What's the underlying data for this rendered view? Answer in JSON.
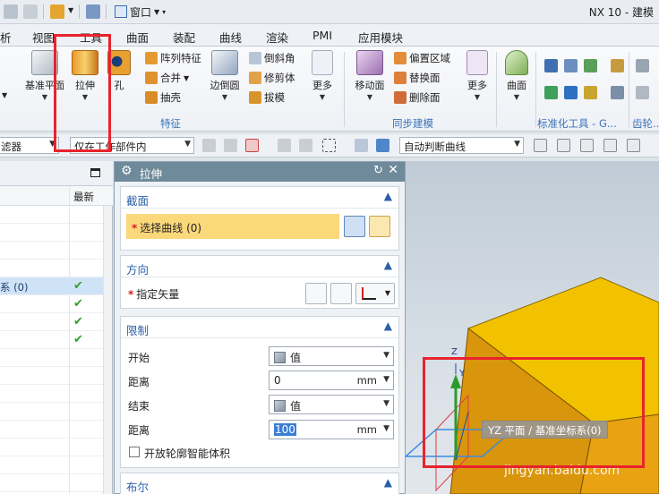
{
  "titlebar": {
    "window_menu_label": "窗口",
    "app_title": "NX 10 - 建模"
  },
  "menu": {
    "tabs": [
      "析",
      "视图",
      "工具",
      "曲面",
      "装配",
      "曲线",
      "渲染",
      "PMI",
      "应用模块"
    ]
  },
  "ribbon": {
    "datum_plane": "基准平面",
    "extrude": "拉伸",
    "hole": "孔",
    "pattern_feature": "阵列特征",
    "unite": "合并",
    "shell": "抽壳",
    "edge_blend": "边倒圆",
    "chamfer": "倒斜角",
    "trim_body": "修剪体",
    "draft": "拔模",
    "more_feature": "更多",
    "feature_group": "特征",
    "move_face": "移动面",
    "offset_region": "偏置区域",
    "replace_face": "替换面",
    "delete_face": "删除面",
    "more_sync": "更多",
    "sync_group": "同步建模",
    "surface": "曲面",
    "std_tools_group": "标准化工具 - G...",
    "gear_group": "齿轮..."
  },
  "selection_bar": {
    "filter_label": "滤器",
    "scope_value": "仅在工作部件内",
    "curve_rule_value": "自动判断曲线"
  },
  "navigator": {
    "column_latest": "最新",
    "selected_row_label": "系 (0)"
  },
  "dialog": {
    "title": "拉伸",
    "section_label": "截面",
    "select_curve_label": "选择曲线 (0)",
    "direction_label": "方向",
    "specify_vector_label": "指定矢量",
    "limits_label": "限制",
    "start_label": "开始",
    "start_value": "值",
    "distance_label_1": "距离",
    "distance_value_1": "0",
    "unit_1": "mm",
    "end_label": "结束",
    "end_value": "值",
    "distance_label_2": "距离",
    "distance_value_2": "100",
    "unit_2": "mm",
    "open_profile_label": "开放轮廓智能体积",
    "boolean_label": "布尔"
  },
  "viewport": {
    "axis_z": "Z",
    "axis_y": "Y",
    "tooltip": "YZ 平面 / 基准坐标系(0)",
    "watermark": "jingyan.baidu.com"
  },
  "colors": {
    "highlight_box": "#e8232c",
    "dialog_title": "#6f8a9a",
    "section_title": "#2b5fa8",
    "required_star": "#d62020",
    "block_top": "#f2c200",
    "block_side": "#d9950c"
  }
}
